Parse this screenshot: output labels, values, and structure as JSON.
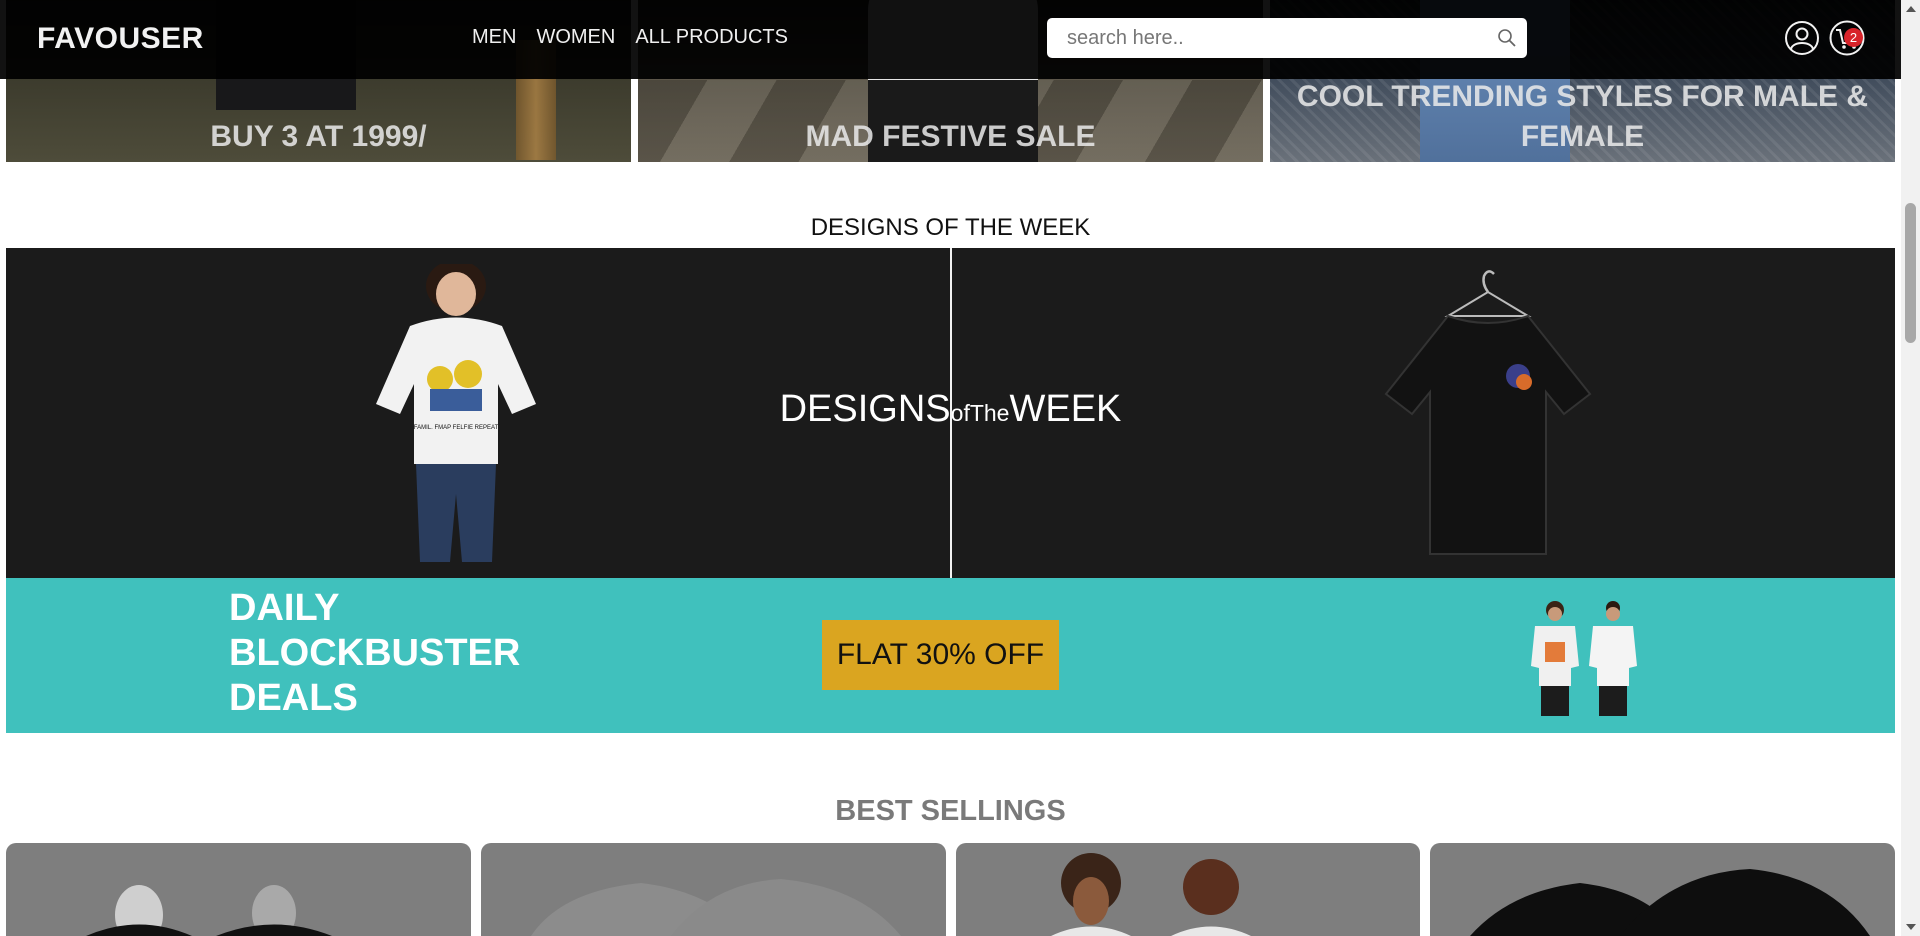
{
  "header": {
    "logo": "FAVOUSER",
    "nav": [
      "MEN",
      "WOMEN",
      "ALL PRODUCTS"
    ],
    "search_placeholder": "search here..",
    "cart_count": "2"
  },
  "hero": {
    "banners": [
      "BUY 3 AT 1999/",
      "MAD FESTIVE SALE",
      "COOL TRENDING STYLES FOR MALE & FEMALE"
    ]
  },
  "designs": {
    "title": "DESIGNS OF THE WEEK",
    "overlay_designs": "DESIGNS",
    "overlay_of": "of",
    "overlay_the": "The",
    "overlay_week": "WEEK",
    "shirt_print_caption": "FAMIL. FMAP FELFIE REPEAT"
  },
  "deals": {
    "title_line1": "DAILY",
    "title_line2": "BLOCKBUSTER",
    "title_line3": "DEALS",
    "button": "FLAT 30% OFF"
  },
  "best": {
    "title": "BEST SELLINGS"
  },
  "colors": {
    "header_bg": "#000000",
    "deals_bg": "#40c1bd",
    "deals_button": "#daa520",
    "dow_panel_bg": "#1b1b1b",
    "cart_badge": "#d8232a",
    "best_title": "#7a7a7a"
  }
}
